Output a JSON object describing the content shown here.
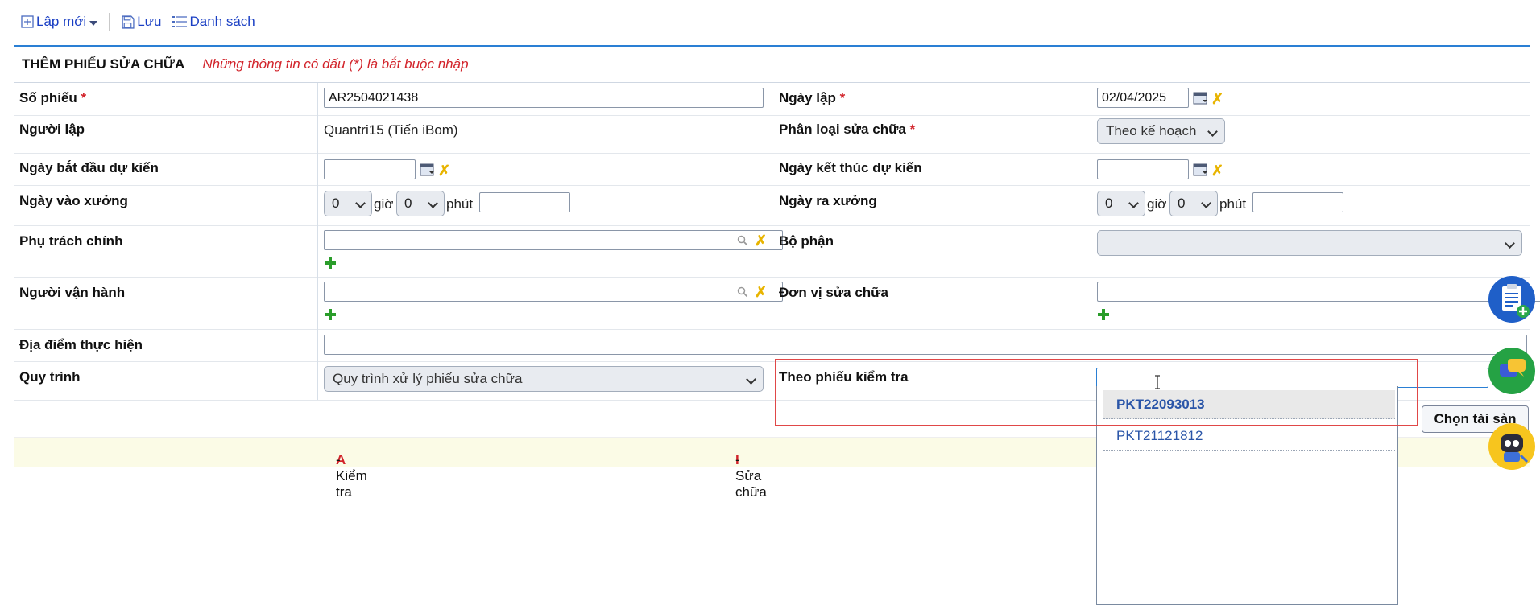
{
  "toolbar": {
    "new_label": "Lập mới",
    "save_label": "Lưu",
    "list_label": "Danh sách"
  },
  "header": {
    "title": "THÊM PHIẾU SỬA CHỮA",
    "note": "Những thông tin có dấu (*) là bắt buộc nhập"
  },
  "form": {
    "so_phieu": {
      "label": "Số phiếu",
      "value": "AR2504021438"
    },
    "ngay_lap": {
      "label": "Ngày lập",
      "value": "02/04/2025"
    },
    "nguoi_lap": {
      "label": "Người lập",
      "value": "Quantri15 (Tiến iBom)"
    },
    "phan_loai": {
      "label": "Phân loại sửa chữa",
      "value": "Theo kế hoạch"
    },
    "ngay_bat_dau": {
      "label": "Ngày bắt đầu dự kiến",
      "value": ""
    },
    "ngay_ket_thuc": {
      "label": "Ngày kết thúc dự kiến",
      "value": ""
    },
    "ngay_vao_xuong": {
      "label": "Ngày vào xưởng",
      "hour": "0",
      "hour_unit": "giờ",
      "minute": "0",
      "minute_unit": "phút",
      "date": ""
    },
    "ngay_ra_xuong": {
      "label": "Ngày ra xưởng",
      "hour": "0",
      "hour_unit": "giờ",
      "minute": "0",
      "minute_unit": "phút",
      "date": ""
    },
    "phu_trach": {
      "label": "Phụ trách chính",
      "value": ""
    },
    "bo_phan": {
      "label": "Bộ phận",
      "value": ""
    },
    "nguoi_van_hanh": {
      "label": "Người vận hành",
      "value": ""
    },
    "don_vi": {
      "label": "Đơn vị sửa chữa",
      "value": ""
    },
    "dia_diem": {
      "label": "Địa điểm thực hiện",
      "value": ""
    },
    "quy_trinh": {
      "label": "Quy trình",
      "value": "Quy trình xử lý phiếu sửa chữa"
    },
    "theo_phieu": {
      "label": "Theo phiếu kiểm tra",
      "value": ""
    }
  },
  "required_mark": "*",
  "dropdown": {
    "items": [
      "PKT22093013",
      "PKT21121812"
    ]
  },
  "buttons": {
    "choose_asset": "Chọn tài sản"
  },
  "legend": {
    "a_key": "A",
    "a_text": "- Kiểm tra",
    "i_key": "I",
    "i_text": "- Sửa chữa"
  },
  "icons": [
    "plus-square-icon",
    "save-icon",
    "list-icon",
    "calendar-icon",
    "clear-icon",
    "search-icon",
    "add-icon",
    "clipboard-add-icon",
    "chat-icon",
    "robot-icon"
  ],
  "colors": {
    "link": "#1a3fc4",
    "required": "#d2232a",
    "header_border": "#2a7fd4",
    "legend_bg": "#fbfbe6",
    "dropdown_item": "#2a55a8"
  }
}
